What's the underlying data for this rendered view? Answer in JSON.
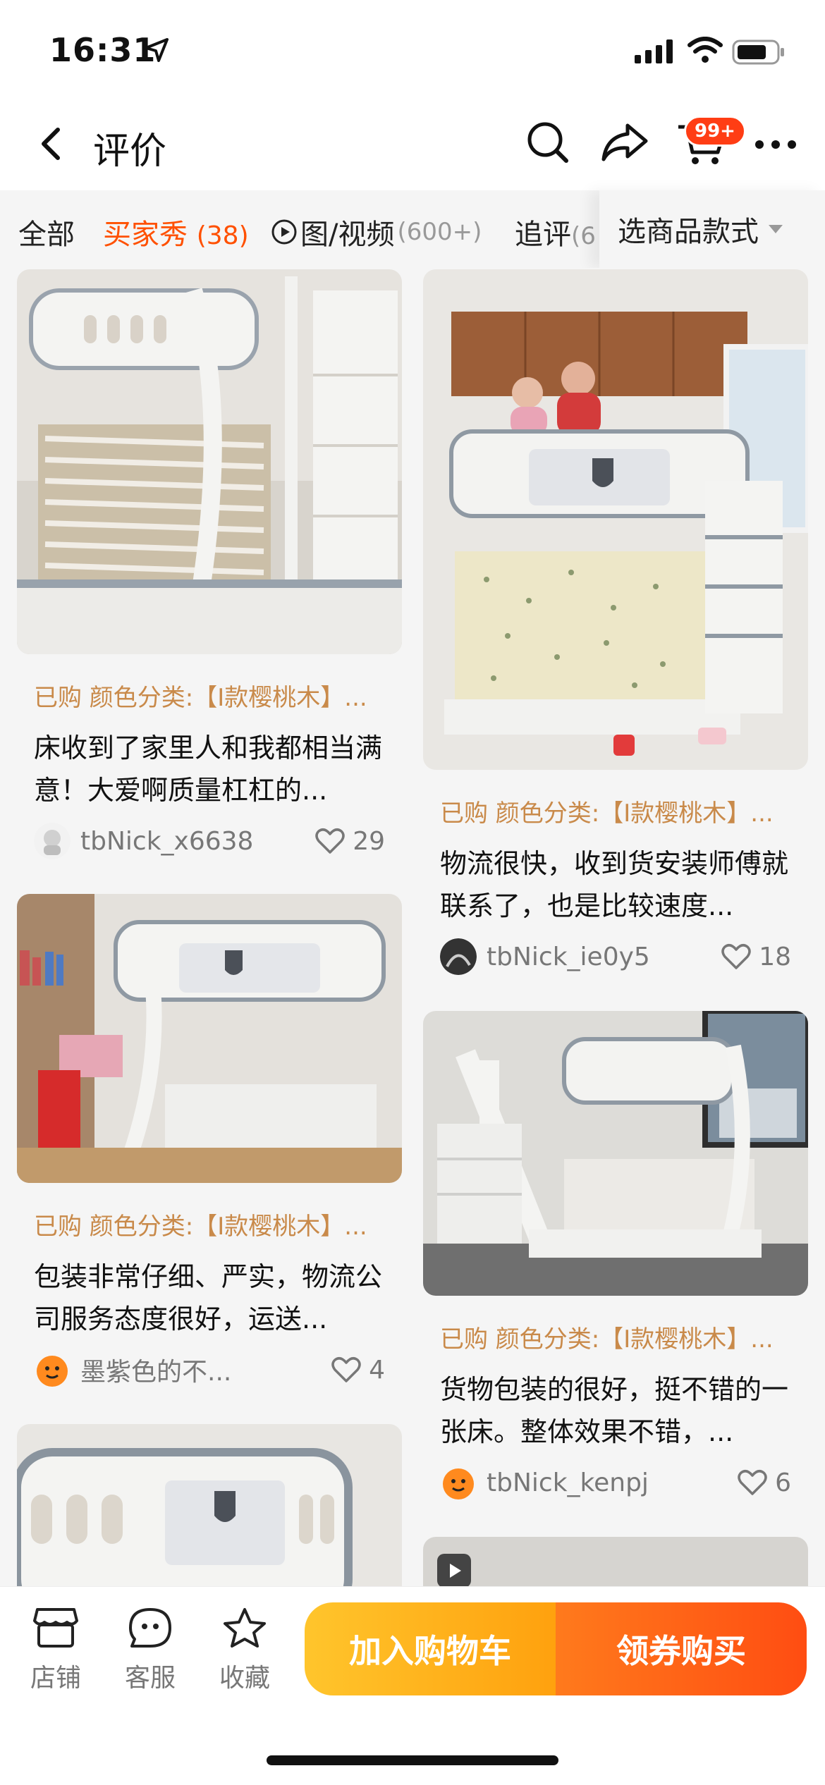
{
  "status_bar": {
    "time": "16:31"
  },
  "nav": {
    "title": "评价",
    "cart_badge": "99+"
  },
  "tabs": {
    "all": "全部",
    "buyer_show": "买家秀",
    "buyer_show_count": "(38)",
    "media": "图/视频",
    "media_count": "(600+)",
    "followup": "追评",
    "followup_count": "(6",
    "filter": "选商品款式"
  },
  "reviews": [
    {
      "variant": "已购 颜色分类:【I款樱桃木】...",
      "text": "床收到了家里人和我都相当满意！大爱啊质量杠杠的...",
      "user": "tbNick_x6638",
      "likes": "29",
      "photo": "photo-1",
      "avatar_color": "#e0e0e0"
    },
    {
      "variant": "已购 颜色分类:【I款樱桃木】...",
      "text": "物流很快，收到货安装师傅就联系了，也是比较速度...",
      "user": "tbNick_ie0y5",
      "likes": "18",
      "photo": "photo-2",
      "avatar_color": "#333333"
    },
    {
      "variant": "已购 颜色分类:【I款樱桃木】...",
      "text": "包装非常仔细、严实，物流公司服务态度很好，运送...",
      "user": "墨紫色的不...",
      "likes": "4",
      "photo": "photo-3",
      "avatar_color": "#ff8a1e"
    },
    {
      "variant": "已购 颜色分类:【I款樱桃木】...",
      "text": "货物包装的很好，挺不错的一张床。整体效果不错，...",
      "user": "tbNick_kenpj",
      "likes": "6",
      "photo": "photo-4",
      "avatar_color": "#ff8a1e"
    }
  ],
  "bottom": {
    "shop": "店铺",
    "service": "客服",
    "favorite": "收藏",
    "add_cart": "加入购物车",
    "coupon_buy": "领券购买"
  },
  "colors": {
    "accent": "#ff5000",
    "variant": "#c98a4a",
    "cart_btn": "#ffb21c",
    "buy_btn": "#ff5a14"
  }
}
